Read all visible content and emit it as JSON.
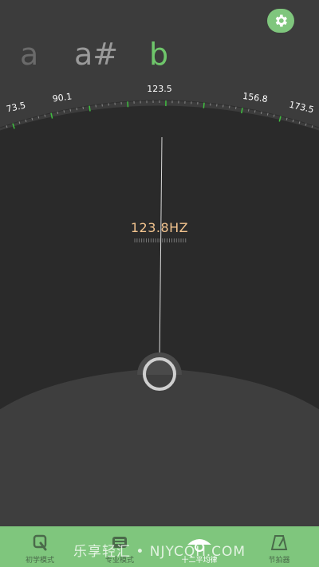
{
  "notes": {
    "previous": "a",
    "previous2": "a#",
    "current": "b"
  },
  "scale": {
    "labels": [
      "73.5",
      "90.1",
      "123.5",
      "156.8",
      "173.5"
    ],
    "center_label": "123.5"
  },
  "reading": {
    "frequency": "123.8HZ"
  },
  "settings": {
    "icon": "gear-icon"
  },
  "colors": {
    "accent": "#7fc67d",
    "note_active": "#6fc66b",
    "freq_text": "#f3c48f",
    "tick_green": "#3fbf3f"
  },
  "nav": {
    "items": [
      {
        "label": "初学模式",
        "icon": "beginner-icon",
        "active": false
      },
      {
        "label": "专业模式",
        "icon": "professional-icon",
        "active": false
      },
      {
        "label": "十二平均律",
        "icon": "equal-temperament-icon",
        "active": true
      },
      {
        "label": "节拍器",
        "icon": "metronome-icon",
        "active": false
      }
    ]
  },
  "watermark": "乐享轻汇 • NJYCQH.COM"
}
